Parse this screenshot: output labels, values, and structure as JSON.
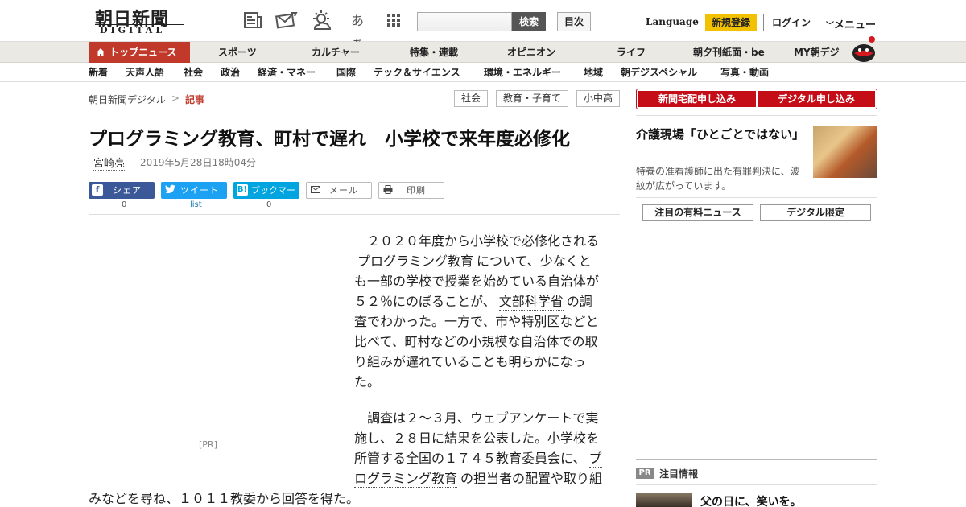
{
  "header": {
    "logo_jp": "朝日新聞",
    "logo_en": "DIGITAL",
    "search_button": "検索",
    "index_button": "目次",
    "language": "Language",
    "signup": "新規登録",
    "login": "ログイン",
    "menu": "メニュー",
    "icons": [
      "newspaper-icon",
      "mail-icon",
      "weather-icon",
      "font-size-icon",
      "grid-icon"
    ],
    "font_size_glyph": "あぁ"
  },
  "nav_main": {
    "active": "トップニュース",
    "items": [
      "スポーツ",
      "カルチャー",
      "特集・連載",
      "オピニオン",
      "ライフ",
      "朝夕刊紙面・be",
      "MY朝デジ"
    ]
  },
  "nav_sub": {
    "items": [
      "新着",
      "天声人語",
      "社会",
      "政治",
      "経済・マネー",
      "国際",
      "テック＆サイエンス",
      "環境・エネルギー",
      "地域",
      "朝デジスペシャル",
      "写真・動画"
    ]
  },
  "breadcrumb": {
    "home": "朝日新聞デジタル",
    "separator": ">",
    "current": "記事"
  },
  "tags": [
    "社会",
    "教育・子育て",
    "小中高"
  ],
  "article": {
    "title": "プログラミング教育、町村で遅れ　小学校で来年度必修化",
    "author": "宮崎亮",
    "date": "2019年5月28日18時04分",
    "share": {
      "facebook": {
        "label": "シェア",
        "count": "0"
      },
      "twitter": {
        "label": "ツイート",
        "count": "list"
      },
      "hatena": {
        "label": "ブックマーク",
        "count": "0"
      },
      "mail": {
        "label": "メール"
      },
      "print": {
        "label": "印刷"
      }
    },
    "p1": {
      "a": "２０２０年度から小学校で必修化される",
      "kw1": "プログラミング教育",
      "b": "について、少なくとも一部の学校で授業を始めている自治体が５２％にのぼることが、",
      "kw2": "文部科学省",
      "c": "の調査でわかった。一方で、市や特別区などと比べて、町村などの小規模な自治体での取り組みが遅れていることも明らかになった。"
    },
    "p2": {
      "a": "調査は２～３月、ウェブアンケートで実施し、２８日に結果を公表した。小学校を所管する全国の１７４５教育委員会に、",
      "kw1": "プログラミング教育",
      "b": "の担当者の配置や取り組"
    },
    "p2_tail": "みなどを尋ね、１０１１教委から回答を得た。",
    "pr": "[PR]"
  },
  "sidebar": {
    "subscribe_paper": "新聞宅配申し込み",
    "subscribe_digital": "デジタル申し込み",
    "feature_title": "介護現場「ひとごとではない」",
    "feature_desc": "特養の准看護師に出た有罪判決に、波紋が広がっています。",
    "tab_paid": "注目の有料ニュース",
    "tab_digital": "デジタル限定",
    "pr_badge": "PR",
    "notice_label": "注目情報",
    "notice_item": "父の日に、笑いを。"
  }
}
